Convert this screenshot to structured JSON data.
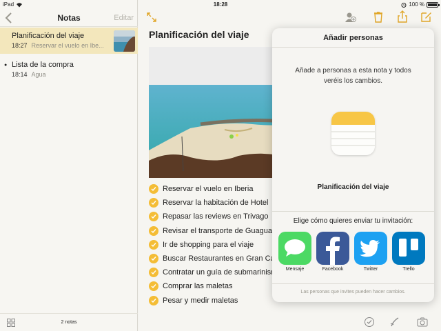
{
  "status": {
    "device": "iPad",
    "time": "18:28",
    "battery": "100 %"
  },
  "sidebar": {
    "title": "Notas",
    "edit_label": "Editar",
    "notes": [
      {
        "title": "Planificación del viaje",
        "time": "18:27",
        "preview": "Reservar el vuelo en Ibe..."
      },
      {
        "title": "Lista de la compra",
        "time": "18:14",
        "preview": "Agua"
      }
    ],
    "footer_count": "2 notas"
  },
  "note": {
    "title": "Planificación del viaje",
    "checklist": [
      "Reservar el vuelo en Iberia",
      "Reservar la habitación de Hotel",
      "Repasar las reviews en Trivago",
      "Revisar el transporte de Guaguas",
      "Ir de shopping para el viaje",
      "Buscar Restaurantes en Gran Can",
      "Contratar un guía de submarinismo",
      "Comprar las maletas",
      "Pesar y medir maletas"
    ],
    "accent_color": "#f4bd36"
  },
  "popover": {
    "title": "Añadir personas",
    "description": "Añade a personas a esta nota y todos veréis los cambios.",
    "note_name": "Planificación del viaje",
    "choose_label": "Elige cómo quieres enviar tu invitación:",
    "apps": [
      {
        "label": "Mensaje",
        "icon": "messages-icon",
        "color": "#4cd964"
      },
      {
        "label": "Facebook",
        "icon": "facebook-icon",
        "color": "#3b5998"
      },
      {
        "label": "Twitter",
        "icon": "twitter-icon",
        "color": "#1da1f2"
      },
      {
        "label": "Trello",
        "icon": "trello-icon",
        "color": "#0079bf"
      }
    ],
    "footer": "Las personas que invites pueden hacer cambios."
  }
}
